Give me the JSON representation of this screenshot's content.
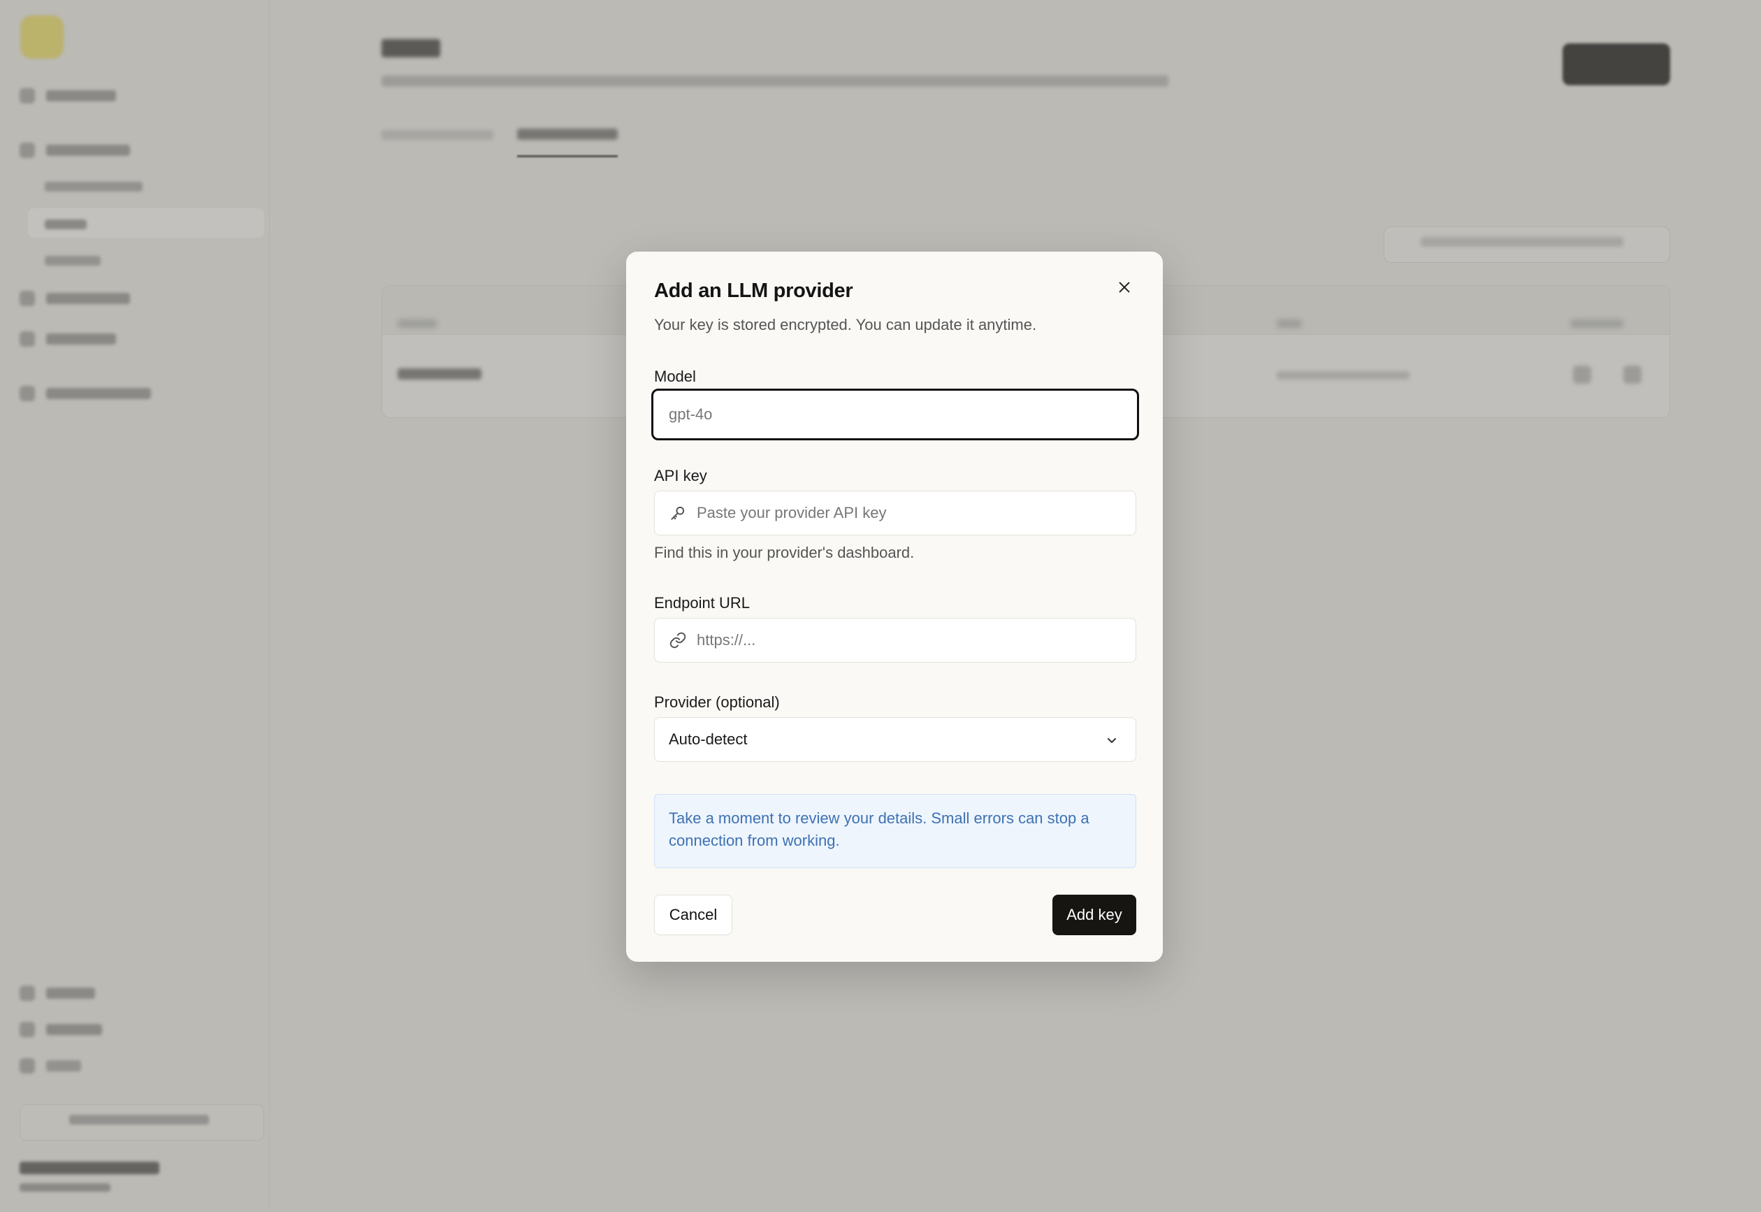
{
  "modal": {
    "title": "Add an LLM provider",
    "subtitle": "Your key is stored encrypted. You can update it anytime.",
    "model": {
      "label": "Model",
      "placeholder": "gpt-4o"
    },
    "api_key": {
      "label": "API key",
      "placeholder": "Paste your provider API key",
      "helper": "Find this in your provider's dashboard."
    },
    "endpoint": {
      "label": "Endpoint URL",
      "placeholder": "https://..."
    },
    "provider": {
      "label": "Provider (optional)",
      "selected": "Auto-detect"
    },
    "notice": "Take a moment to review your details. Small errors can stop a connection from working.",
    "cancel_label": "Cancel",
    "submit_label": "Add key"
  },
  "colors": {
    "accent": "#161512",
    "notice_text": "#3e71b3",
    "notice_bg": "#eef5fd",
    "logo": "#f3e36b"
  },
  "icons": [
    "close-icon",
    "key-icon",
    "link-icon",
    "chevron-down-icon"
  ]
}
